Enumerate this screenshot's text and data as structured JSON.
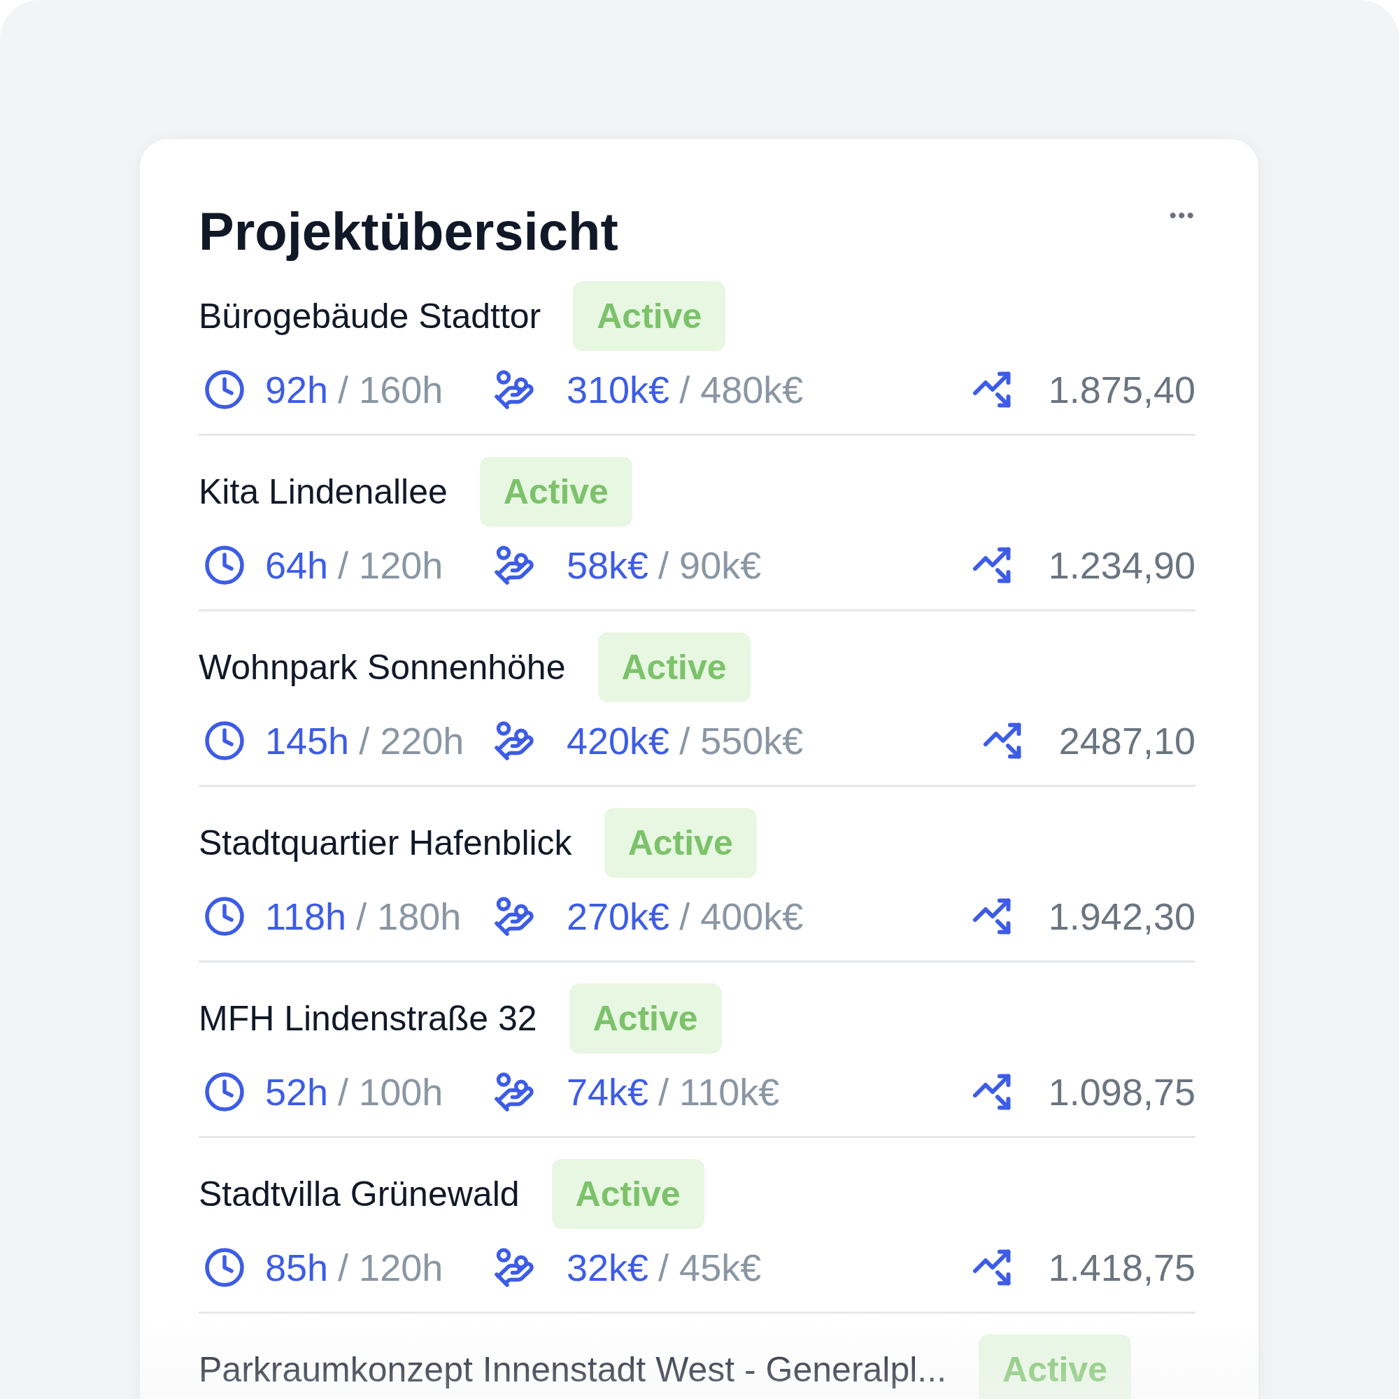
{
  "card": {
    "title": "Projektübersicht",
    "menu": "•••"
  },
  "projects": [
    {
      "name": "Bürogebäude Stadttor",
      "status": "Active",
      "hours": "92h",
      "hours_limit": "/ 160h",
      "budget": "310k€",
      "budget_limit": "/ 480k€",
      "value": "1.875,40"
    },
    {
      "name": "Kita Lindenallee",
      "status": "Active",
      "hours": "64h",
      "hours_limit": "/ 120h",
      "budget": "58k€",
      "budget_limit": "/ 90k€",
      "value": "1.234,90"
    },
    {
      "name": "Wohnpark Sonnenhöhe",
      "status": "Active",
      "hours": "145h",
      "hours_limit": "/ 220h",
      "budget": "420k€",
      "budget_limit": "/ 550k€",
      "value": "2487,10"
    },
    {
      "name": "Stadtquartier Hafenblick",
      "status": "Active",
      "hours": "118h",
      "hours_limit": "/ 180h",
      "budget": "270k€",
      "budget_limit": "/ 400k€",
      "value": "1.942,30"
    },
    {
      "name": "MFH Lindenstraße 32",
      "status": "Active",
      "hours": "52h",
      "hours_limit": "/ 100h",
      "budget": "74k€",
      "budget_limit": "/ 110k€",
      "value": "1.098,75"
    },
    {
      "name": "Stadtvilla Grünewald",
      "status": "Active",
      "hours": "85h",
      "hours_limit": "/ 120h",
      "budget": "32k€",
      "budget_limit": "/ 45k€",
      "value": "1.418,75"
    },
    {
      "name": "Parkraumkonzept Innenstadt West - Generalpl...",
      "status": "Active"
    }
  ]
}
